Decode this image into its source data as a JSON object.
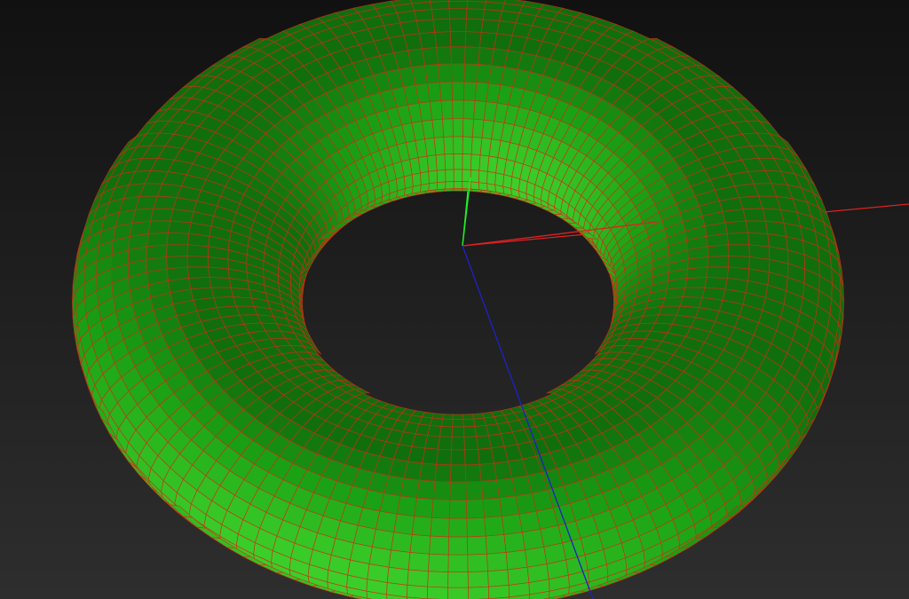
{
  "viewport": {
    "background_top": "#111111",
    "background_bottom": "#2e2e2e",
    "render_mode": "shaded-wireframe",
    "mesh": {
      "object": "torus",
      "surface_color": "#1aa014",
      "surface_highlight": "#3ccf2a",
      "surface_shadow": "#0a4a08",
      "wire_color": "#d42a14",
      "rings": 32,
      "segments": 118
    },
    "axes": {
      "x": {
        "color": "#e02020"
      },
      "y": {
        "color": "#22ee22"
      },
      "z": {
        "color": "#2020c8"
      }
    }
  }
}
